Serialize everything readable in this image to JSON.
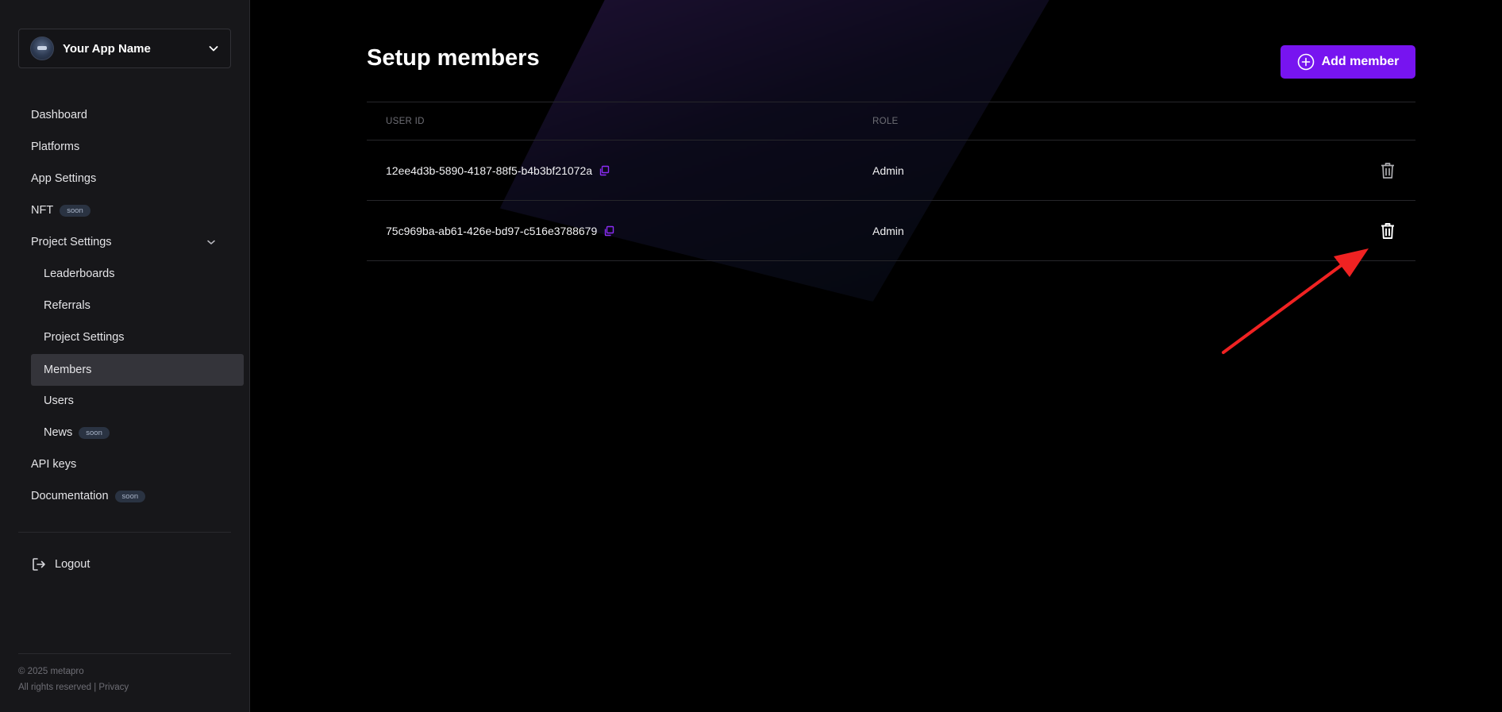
{
  "sidebar": {
    "app_name": "Your App Name",
    "items": [
      {
        "label": "Dashboard"
      },
      {
        "label": "Platforms"
      },
      {
        "label": "App Settings"
      },
      {
        "label": "NFT",
        "badge": "soon"
      },
      {
        "label": "Project Settings",
        "expanded": true
      },
      {
        "label": "Leaderboards"
      },
      {
        "label": "Referrals"
      },
      {
        "label": "Project Settings"
      },
      {
        "label": "Members",
        "active": true
      },
      {
        "label": "Users"
      },
      {
        "label": "News",
        "badge": "soon"
      },
      {
        "label": "API keys"
      },
      {
        "label": "Documentation",
        "badge": "soon"
      }
    ],
    "logout": "Logout",
    "footer": {
      "copyright": "© 2025 metapro",
      "rights": "All rights reserved | ",
      "privacy": "Privacy"
    }
  },
  "main": {
    "title": "Setup members",
    "add_button": "Add member",
    "table": {
      "columns": [
        "USER ID",
        "ROLE"
      ],
      "rows": [
        {
          "user_id": "12ee4d3b-5890-4187-88f5-b4b3bf21072a",
          "role": "Admin"
        },
        {
          "user_id": "75c969ba-ab61-426e-bd97-c516e3788679",
          "role": "Admin"
        }
      ]
    }
  },
  "colors": {
    "accent": "#7714f0",
    "annotation_arrow": "#f02222"
  },
  "icons": [
    "chevron-down-icon",
    "logout-icon",
    "plus-circle-icon",
    "copy-icon",
    "trash-icon"
  ]
}
